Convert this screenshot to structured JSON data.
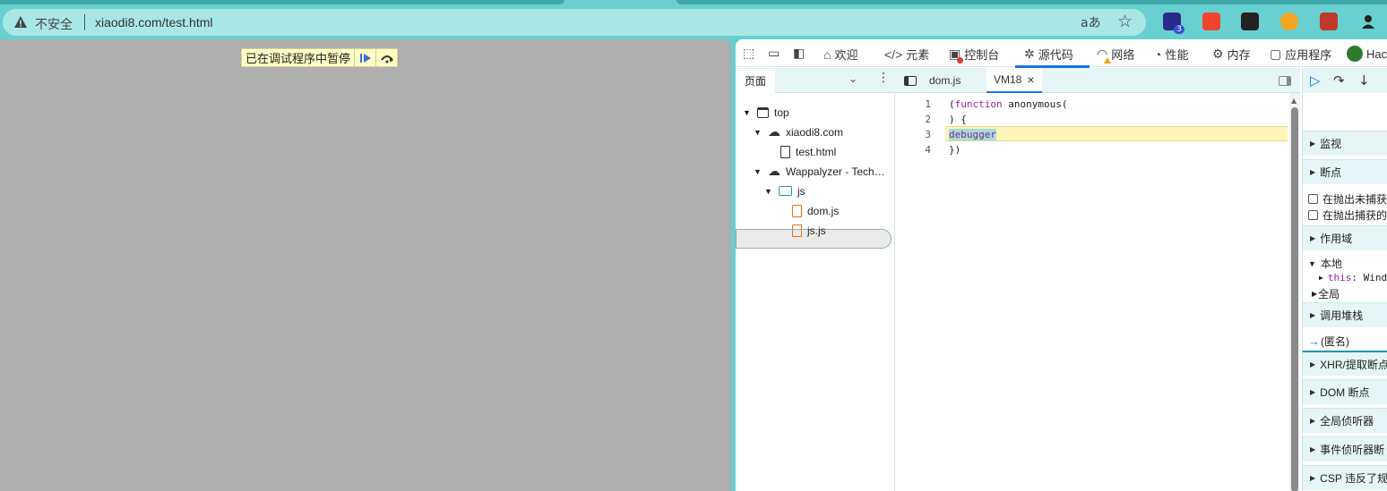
{
  "browser": {
    "security_label": "不安全",
    "url": "xiaodi8.com/test.html",
    "read_aloud_icon": "aあ",
    "extension_badge": "3"
  },
  "page": {
    "paused_banner": "已在调试程序中暂停"
  },
  "devtools": {
    "tabs": [
      {
        "label": "欢迎",
        "icon": "home-icon"
      },
      {
        "label": "元素",
        "icon": "code-icon"
      },
      {
        "label": "控制台",
        "icon": "console-icon"
      },
      {
        "label": "源代码",
        "icon": "bug-icon"
      },
      {
        "label": "网络",
        "icon": "wifi-icon"
      },
      {
        "label": "性能",
        "icon": "gauge-icon"
      },
      {
        "label": "内存",
        "icon": "chip-icon"
      },
      {
        "label": "应用程序",
        "icon": "app-icon"
      },
      {
        "label": "Hac",
        "icon": "extension-icon"
      }
    ],
    "navigator": {
      "tab_label": "页面",
      "tree": [
        {
          "label": "top",
          "icon": "frame-icon"
        },
        {
          "label": "xiaodi8.com",
          "icon": "cloud-icon"
        },
        {
          "label": "test.html",
          "icon": "file-icon"
        },
        {
          "label": "Wappalyzer - Tech…",
          "icon": "cloud-icon"
        },
        {
          "label": "js",
          "icon": "folder-icon"
        },
        {
          "label": "dom.js",
          "icon": "js-file-icon"
        },
        {
          "label": "js.js",
          "icon": "js-file-icon"
        }
      ]
    },
    "editor": {
      "tabs": [
        "dom.js",
        "VM18"
      ],
      "line_numbers": [
        "1",
        "2",
        "3",
        "4"
      ],
      "lines": {
        "l1_paren": "(",
        "l1_kw": "function",
        "l1_rest": " anonymous(",
        "l2": ") {",
        "l3": "debugger",
        "l4": "})"
      }
    },
    "sidebar": {
      "watch": "监视",
      "breakpoints": "断点",
      "pause_uncaught": "在抛出未捕获",
      "pause_caught": "在抛出捕获的",
      "scope": "作用域",
      "local": "本地",
      "this_key": "this",
      "this_val": ": Wind",
      "global": "全局",
      "call_stack": "调用堆栈",
      "anon_frame": "(匿名)",
      "xhr": "XHR/提取断点",
      "dom_bp": "DOM 断点",
      "global_listeners": "全局侦听器",
      "event_listener_bp": "事件侦听器断",
      "csp": "CSP 违反了规"
    }
  }
}
